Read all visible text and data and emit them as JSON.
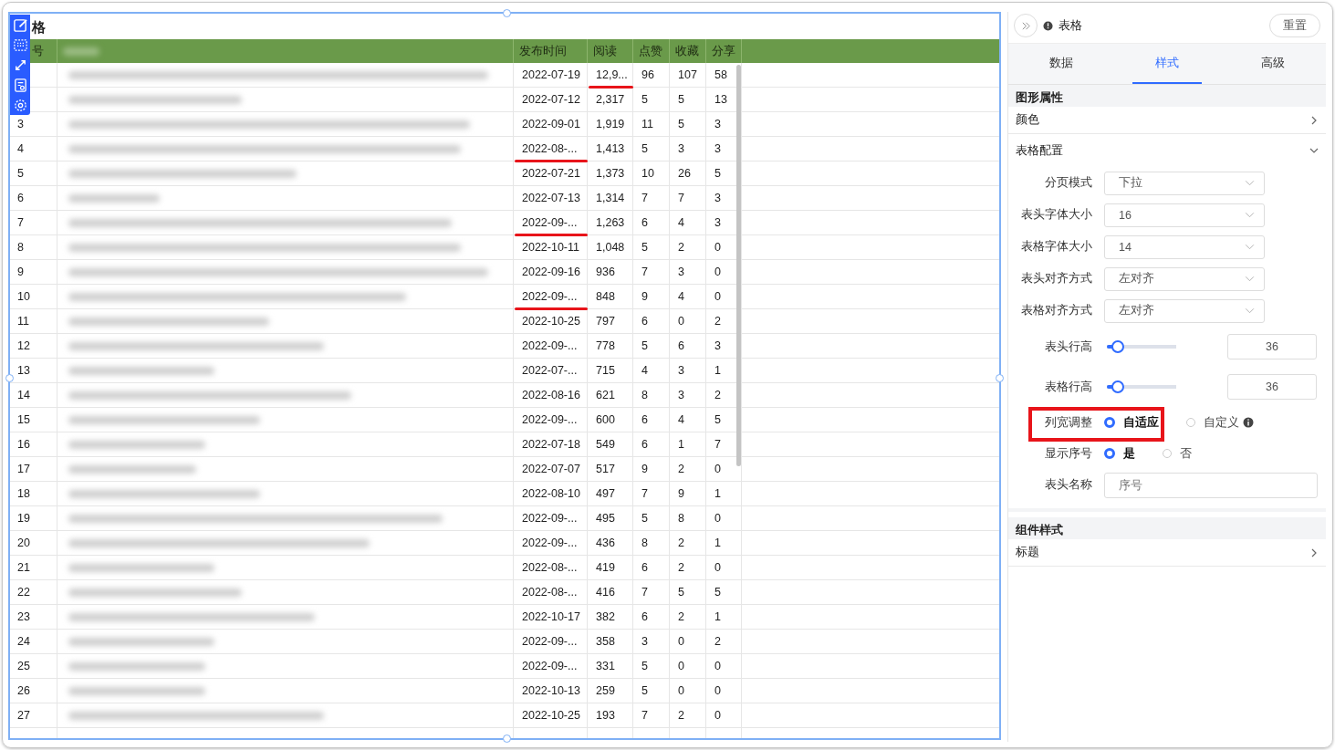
{
  "canvas": {
    "title": "格"
  },
  "table": {
    "columns": [
      "号",
      "发布时间",
      "阅读",
      "点赞",
      "收藏",
      "分享"
    ],
    "rows": [
      {
        "date": "2022-07-19",
        "read": "12,9...",
        "like": "96",
        "fav": "107",
        "share": "58",
        "read_underlined": true
      },
      {
        "date": "2022-07-12",
        "read": "2,317",
        "like": "5",
        "fav": "5",
        "share": "13"
      },
      {
        "index": "3",
        "date": "2022-09-01",
        "read": "1,919",
        "like": "11",
        "fav": "5",
        "share": "3"
      },
      {
        "index": "4",
        "date": "2022-08-...",
        "read": "1,413",
        "like": "5",
        "fav": "3",
        "share": "3",
        "date_underlined": true
      },
      {
        "index": "5",
        "date": "2022-07-21",
        "read": "1,373",
        "like": "10",
        "fav": "26",
        "share": "5"
      },
      {
        "index": "6",
        "date": "2022-07-13",
        "read": "1,314",
        "like": "7",
        "fav": "7",
        "share": "3"
      },
      {
        "index": "7",
        "date": "2022-09-...",
        "read": "1,263",
        "like": "6",
        "fav": "4",
        "share": "3",
        "date_underlined": true
      },
      {
        "index": "8",
        "date": "2022-10-11",
        "read": "1,048",
        "like": "5",
        "fav": "2",
        "share": "0"
      },
      {
        "index": "9",
        "date": "2022-09-16",
        "read": "936",
        "like": "7",
        "fav": "3",
        "share": "0"
      },
      {
        "index": "10",
        "date": "2022-09-...",
        "read": "848",
        "like": "9",
        "fav": "4",
        "share": "0",
        "date_underlined": true
      },
      {
        "index": "11",
        "date": "2022-10-25",
        "read": "797",
        "like": "6",
        "fav": "0",
        "share": "2"
      },
      {
        "index": "12",
        "date": "2022-09-...",
        "read": "778",
        "like": "5",
        "fav": "6",
        "share": "3"
      },
      {
        "index": "13",
        "date": "2022-07-...",
        "read": "715",
        "like": "4",
        "fav": "3",
        "share": "1"
      },
      {
        "index": "14",
        "date": "2022-08-16",
        "read": "621",
        "like": "8",
        "fav": "3",
        "share": "2"
      },
      {
        "index": "15",
        "date": "2022-09-...",
        "read": "600",
        "like": "6",
        "fav": "4",
        "share": "5"
      },
      {
        "index": "16",
        "date": "2022-07-18",
        "read": "549",
        "like": "6",
        "fav": "1",
        "share": "7"
      },
      {
        "index": "17",
        "date": "2022-07-07",
        "read": "517",
        "like": "9",
        "fav": "2",
        "share": "0"
      },
      {
        "index": "18",
        "date": "2022-08-10",
        "read": "497",
        "like": "7",
        "fav": "9",
        "share": "1"
      },
      {
        "index": "19",
        "date": "2022-09-...",
        "read": "495",
        "like": "5",
        "fav": "8",
        "share": "0"
      },
      {
        "index": "20",
        "date": "2022-09-...",
        "read": "436",
        "like": "8",
        "fav": "2",
        "share": "1"
      },
      {
        "index": "21",
        "date": "2022-08-...",
        "read": "419",
        "like": "6",
        "fav": "2",
        "share": "0"
      },
      {
        "index": "22",
        "date": "2022-08-...",
        "read": "416",
        "like": "7",
        "fav": "5",
        "share": "5"
      },
      {
        "index": "23",
        "date": "2022-10-17",
        "read": "382",
        "like": "6",
        "fav": "2",
        "share": "1"
      },
      {
        "index": "24",
        "date": "2022-09-...",
        "read": "358",
        "like": "3",
        "fav": "0",
        "share": "2"
      },
      {
        "index": "25",
        "date": "2022-09-...",
        "read": "331",
        "like": "5",
        "fav": "0",
        "share": "0"
      },
      {
        "index": "26",
        "date": "2022-10-13",
        "read": "259",
        "like": "5",
        "fav": "0",
        "share": "0"
      },
      {
        "index": "27",
        "date": "2022-10-25",
        "read": "193",
        "like": "7",
        "fav": "2",
        "share": "0"
      }
    ]
  },
  "panel": {
    "title": "表格",
    "reset_button": "重置",
    "tabs": [
      {
        "label": "数据",
        "selected": false
      },
      {
        "label": "样式",
        "selected": true
      },
      {
        "label": "高级",
        "selected": false
      }
    ],
    "section_1": "图形属性",
    "color_row": "颜色",
    "table_config": {
      "label": "表格配置",
      "expanded": true
    },
    "settings": [
      {
        "kind": "select",
        "label": "分页模式",
        "value": "下拉"
      },
      {
        "kind": "select",
        "label": "表头字体大小",
        "value": "16"
      },
      {
        "kind": "select",
        "label": "表格字体大小",
        "value": "14"
      },
      {
        "kind": "select",
        "label": "表头对齐方式",
        "value": "左对齐"
      },
      {
        "kind": "select",
        "label": "表格对齐方式",
        "value": "左对齐"
      },
      {
        "kind": "slider",
        "label": "表头行高",
        "level": 0.16,
        "value": "36"
      },
      {
        "kind": "slider",
        "label": "表格行高",
        "level": 0.16,
        "value": "36"
      },
      {
        "kind": "radio",
        "label": "列宽调整",
        "highlighted": true,
        "options": [
          {
            "label": "自适应",
            "selected": true
          },
          {
            "label": "自定义",
            "selected": false,
            "info": true
          }
        ]
      },
      {
        "kind": "radio",
        "label": "显示序号",
        "options": [
          {
            "label": "是",
            "selected": true
          },
          {
            "label": "否",
            "selected": false
          }
        ]
      },
      {
        "kind": "text",
        "label": "表头名称",
        "placeholder": "序号"
      }
    ],
    "section_2": "组件样式",
    "title_row": "标题"
  }
}
